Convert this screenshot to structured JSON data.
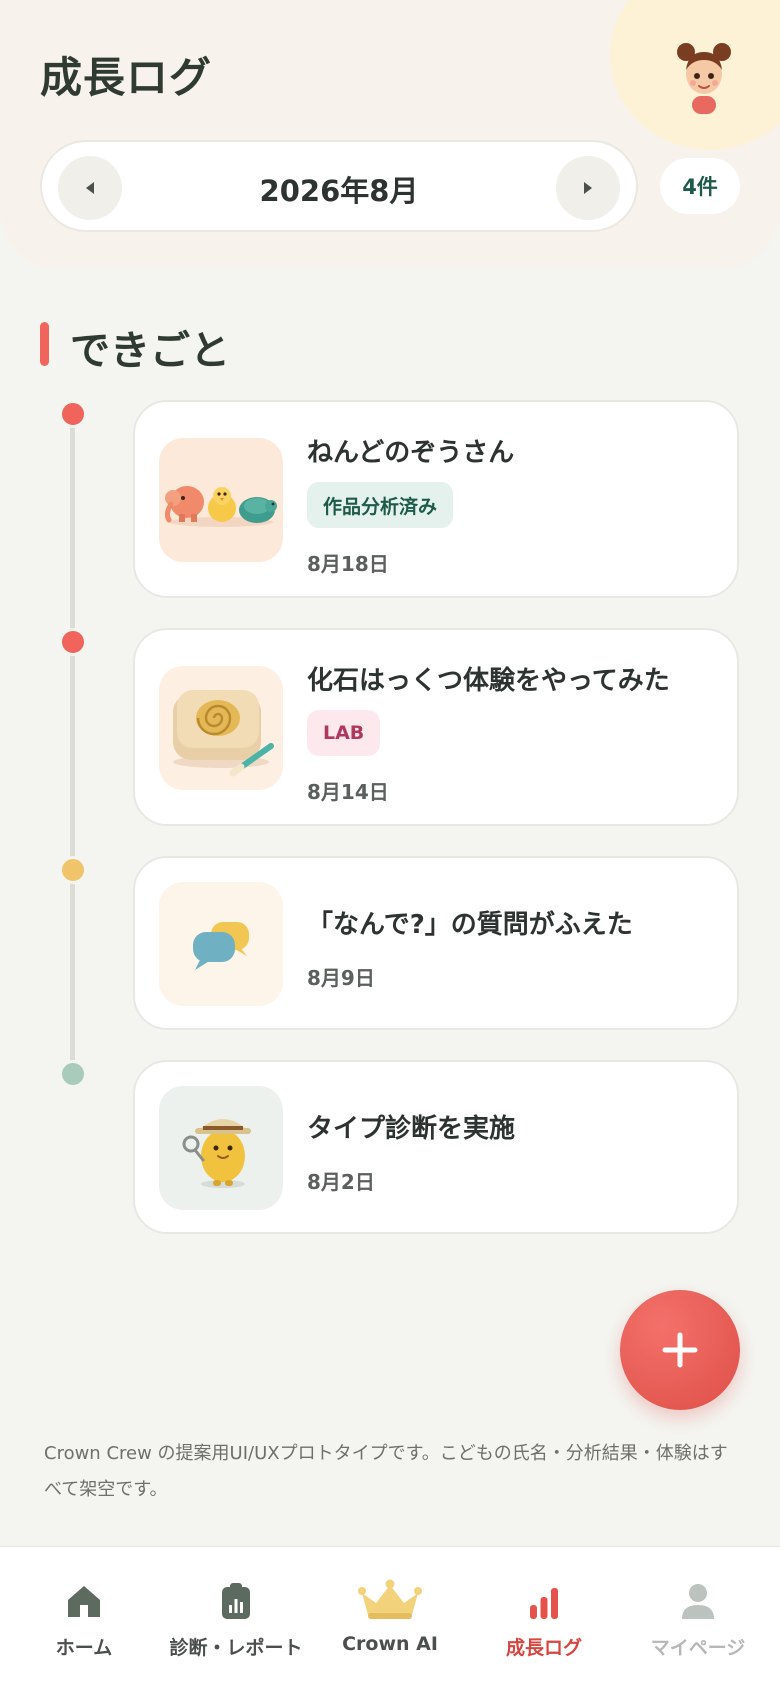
{
  "header": {
    "title": "成長ログ",
    "month_label": "2026年8月",
    "count_label": "4件"
  },
  "section": {
    "title": "できごと"
  },
  "entries": [
    {
      "title": "ねんどのぞうさん",
      "tag": "作品分析済み",
      "date": "8月18日",
      "thumb_icon": "clay-animals-icon",
      "dot_color": "#f0645c"
    },
    {
      "title": "化石はっくつ体験をやってみた",
      "tag": "LAB",
      "date": "8月14日",
      "thumb_icon": "fossil-icon",
      "dot_color": "#f0645c"
    },
    {
      "title": "「なんで?」の質問がふえた",
      "date": "8月9日",
      "thumb_icon": "speech-bubbles-icon",
      "dot_color": "#efc46b"
    },
    {
      "title": "タイプ診断を実施",
      "date": "8月2日",
      "thumb_icon": "explorer-character-icon",
      "dot_color": "#a9cbbb"
    }
  ],
  "fab": {
    "icon": "plus-icon"
  },
  "footnote": "Crown Crew の提案用UI/UXプロトタイプです。こどもの氏名・分析結果・体験はすべて架空です。",
  "nav": {
    "items": [
      {
        "label": "ホーム",
        "icon": "home-icon"
      },
      {
        "label": "診断・レポート",
        "icon": "report-icon"
      },
      {
        "label": "Crown AI",
        "icon": "crown-icon"
      },
      {
        "label": "成長ログ",
        "icon": "bar-chart-icon",
        "active": true
      },
      {
        "label": "マイページ",
        "icon": "person-icon"
      }
    ]
  },
  "colors": {
    "accent": "#f0645c",
    "active_nav": "#d9463f",
    "teal_text": "#1e5a4a",
    "lab_text": "#b0385e"
  }
}
